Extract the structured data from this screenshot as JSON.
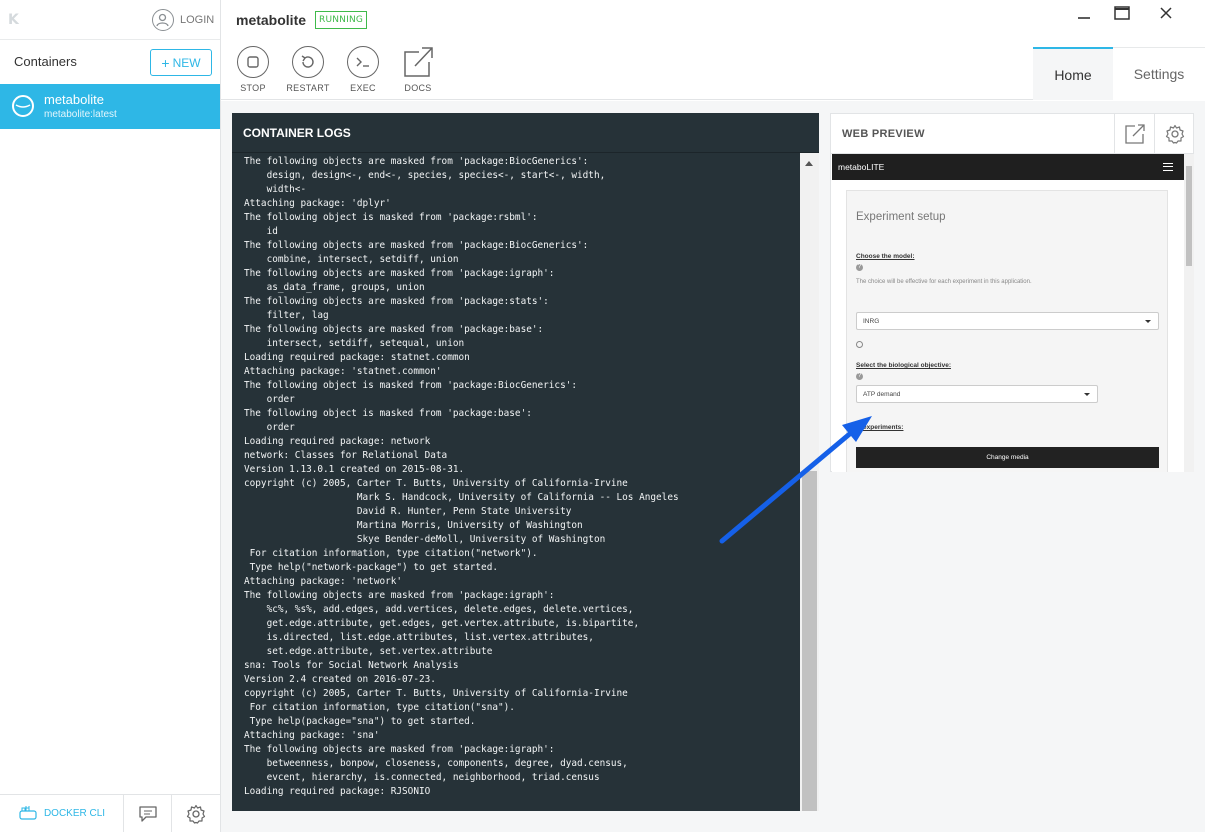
{
  "app": {
    "logo": "K"
  },
  "sidebar": {
    "login_label": "LOGIN",
    "containers_title": "Containers",
    "new_button": "NEW",
    "containers": [
      {
        "name": "metabolite",
        "image": "metabolite:latest",
        "selected": true
      }
    ],
    "bottom": {
      "docker_cli": "DOCKER CLI"
    }
  },
  "header": {
    "container_name": "metabolite",
    "status": "RUNNING",
    "actions": [
      {
        "label": "STOP",
        "icon": "stop-icon"
      },
      {
        "label": "RESTART",
        "icon": "restart-icon"
      },
      {
        "label": "EXEC",
        "icon": "terminal-icon"
      },
      {
        "label": "DOCS",
        "icon": "external-link-icon"
      }
    ],
    "tabs": [
      {
        "label": "Home",
        "active": true
      },
      {
        "label": "Settings",
        "active": false
      }
    ]
  },
  "logs": {
    "title": "CONTAINER LOGS",
    "lines": [
      "The following objects are masked from 'package:BiocGenerics':",
      "    design, design<-, end<-, species, species<-, start<-, width,",
      "    width<-",
      "Attaching package: 'dplyr'",
      "The following object is masked from 'package:rsbml':",
      "    id",
      "The following objects are masked from 'package:BiocGenerics':",
      "    combine, intersect, setdiff, union",
      "The following objects are masked from 'package:igraph':",
      "    as_data_frame, groups, union",
      "The following objects are masked from 'package:stats':",
      "    filter, lag",
      "The following objects are masked from 'package:base':",
      "    intersect, setdiff, setequal, union",
      "Loading required package: statnet.common",
      "Attaching package: 'statnet.common'",
      "The following object is masked from 'package:BiocGenerics':",
      "    order",
      "The following object is masked from 'package:base':",
      "    order",
      "Loading required package: network",
      "network: Classes for Relational Data",
      "Version 1.13.0.1 created on 2015-08-31.",
      "copyright (c) 2005, Carter T. Butts, University of California-Irvine",
      "                    Mark S. Handcock, University of California -- Los Angeles",
      "                    David R. Hunter, Penn State University",
      "                    Martina Morris, University of Washington",
      "                    Skye Bender-deMoll, University of Washington",
      " For citation information, type citation(\"network\").",
      " Type help(\"network-package\") to get started.",
      "Attaching package: 'network'",
      "The following objects are masked from 'package:igraph':",
      "    %c%, %s%, add.edges, add.vertices, delete.edges, delete.vertices,",
      "    get.edge.attribute, get.edges, get.vertex.attribute, is.bipartite,",
      "    is.directed, list.edge.attributes, list.vertex.attributes,",
      "    set.edge.attribute, set.vertex.attribute",
      "sna: Tools for Social Network Analysis",
      "Version 2.4 created on 2016-07-23.",
      "copyright (c) 2005, Carter T. Butts, University of California-Irvine",
      " For citation information, type citation(\"sna\").",
      " Type help(package=\"sna\") to get started.",
      "Attaching package: 'sna'",
      "The following objects are masked from 'package:igraph':",
      "    betweenness, bonpow, closeness, components, degree, dyad.census,",
      "    evcent, hierarchy, is.connected, neighborhood, triad.census",
      "Loading required package: RJSONIO"
    ]
  },
  "preview": {
    "title": "WEB PREVIEW",
    "app_name": "metaboLITE",
    "panel_title": "Experiment setup",
    "model_label": "Choose the model:",
    "model_help": "The choice will be effective for each experiment in this application.",
    "model_value": "INRG",
    "objective_label": "Select the biological objective:",
    "objective_value": "ATP demand",
    "experiments_label": "experiments:",
    "change_media_button": "Change media"
  },
  "colors": {
    "accent": "#2eb7e6",
    "running": "#3fba4a",
    "log_bg": "#263238",
    "annotation_arrow": "#1560e8"
  }
}
